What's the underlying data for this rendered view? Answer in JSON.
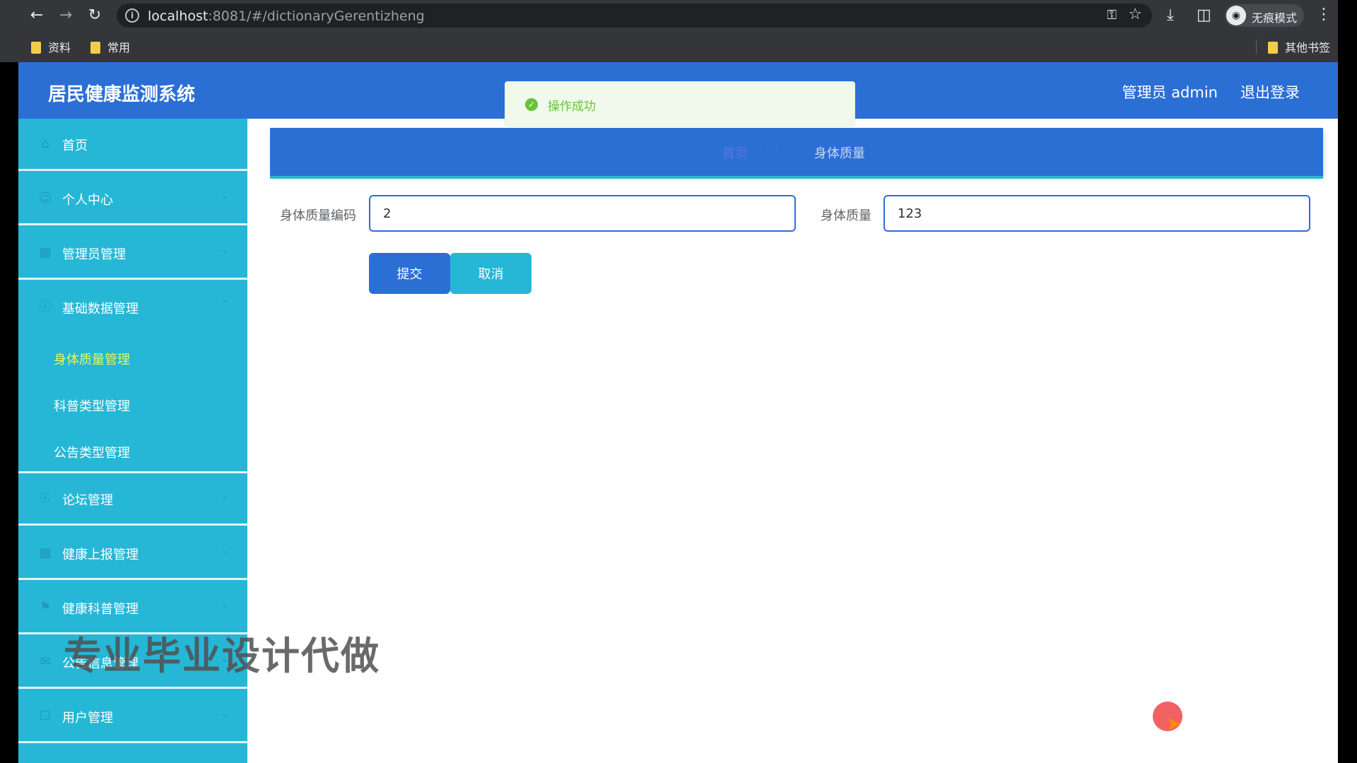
{
  "browser": {
    "url_host": "localhost",
    "url_rest": ":8081/#/dictionaryGerentizheng",
    "profile_label": "无痕模式",
    "bookmarks": [
      "资料",
      "常用"
    ],
    "other_bookmarks": "其他书签"
  },
  "header": {
    "title": "居民健康监测系统",
    "user": "管理员 admin",
    "logout": "退出登录"
  },
  "toast": {
    "message": "操作成功",
    "color": "#67c23a"
  },
  "sidebar": {
    "items": [
      {
        "label": "首页",
        "icon": "home-icon"
      },
      {
        "label": "个人中心",
        "icon": "user-icon"
      },
      {
        "label": "管理员管理",
        "icon": "admin-icon"
      },
      {
        "label": "基础数据管理",
        "icon": "info-icon"
      },
      {
        "label": "论坛管理",
        "icon": "forum-icon"
      },
      {
        "label": "健康上报管理",
        "icon": "report-icon"
      },
      {
        "label": "健康科普管理",
        "icon": "flag-icon"
      },
      {
        "label": "公告信息管理",
        "icon": "notice-icon"
      },
      {
        "label": "用户管理",
        "icon": "users-icon"
      }
    ],
    "sub_items": [
      {
        "label": "身体质量管理",
        "active": true
      },
      {
        "label": "科普类型管理",
        "active": false
      },
      {
        "label": "公告类型管理",
        "active": false
      }
    ]
  },
  "breadcrumb": {
    "home": "首页",
    "current": "身体质量"
  },
  "form": {
    "code_label": "身体质量编码",
    "code_value": "2",
    "name_label": "身体质量",
    "name_value": "123",
    "submit": "提交",
    "cancel": "取消"
  },
  "watermark": "专业毕业设计代做",
  "colors": {
    "primary": "#2b6fd5",
    "sidebar": "#26b7d6",
    "active_sub": "#e7f55a"
  }
}
